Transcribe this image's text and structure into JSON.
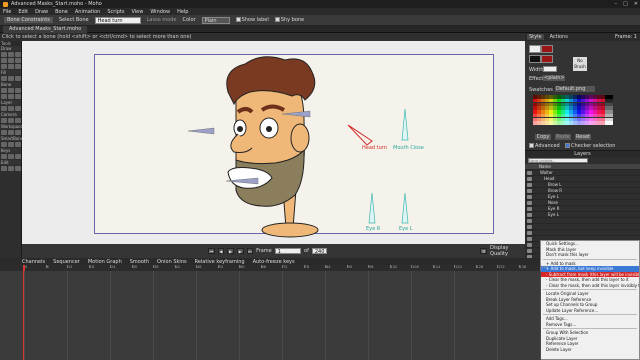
{
  "window": {
    "title": "Advanced Masks_Start.moho - Moho"
  },
  "menu": [
    "File",
    "Edit",
    "Draw",
    "Bone",
    "Animation",
    "Scripts",
    "View",
    "Window",
    "Help"
  ],
  "options": {
    "bone_constraints": "Bone Constraints",
    "select_bone": "Select Bone",
    "bone_name": "Head turn",
    "lasso_mode": "Lasso mode",
    "color_label": "Color",
    "color_value": "Plain",
    "show_label": "Show label",
    "shy_bone": "Shy bone"
  },
  "doc_tab": "Advanced Masks_Start.moho",
  "hint": "Click to select a bone (hold <shift> or <ctrl/cmd> to select more than one)",
  "frame_readout": "Frame: 1",
  "tools_sections": [
    "Draw",
    "Fill",
    "Bone",
    "Layer",
    "Camera",
    "Workspace",
    "SmartBones",
    "Keys",
    "Edit"
  ],
  "tools_title": "Tools",
  "style_panel": {
    "tabs": [
      "Style",
      "Actions"
    ],
    "width_label": "Width",
    "effect_label": "Effect",
    "effect_value": "<plain>",
    "no_brush": "No Brush",
    "swatches_label": "Swatches",
    "swatches_file": "Default.png",
    "copy": "Copy",
    "paste": "Paste",
    "reset": "Reset",
    "advanced": "Advanced",
    "checker": "Checker selection"
  },
  "layers": {
    "title": "Layers",
    "search_placeholder": "Name contains...",
    "col_name": "Name",
    "rows": [
      "Walter",
      "Head",
      "Brow L",
      "Brow R",
      "Eye L",
      "Nose",
      "Eye R",
      "Eye L"
    ]
  },
  "bone_labels": {
    "head_turn": "Head turn",
    "mouth_close": "Mouth Close",
    "eye_r": "Eye R",
    "eye_l": "Eye L"
  },
  "context_menu": [
    "Quick Settings...",
    "Mask this layer",
    "Don't mask this layer",
    "+ Add to mask",
    "+ Add to mask, but keep invisible",
    "- Subtract from mask (this layer will be invisible)",
    "- Clear the mask, then add this layer to it",
    "- Clear the mask, then add this layer invisibly to it",
    "Locate Original Layer",
    "Break Layer Reference",
    "Set up Channels to Group",
    "Update Layer Reference...",
    "Add Tags...",
    "Remove Tags...",
    "Group With Selection",
    "Duplicate Layer",
    "Reference Layer",
    "Delete Layer"
  ],
  "playbar": {
    "frame_label": "Frame",
    "frame_value": "1",
    "of_label": "of",
    "end_value": "240",
    "display_quality": "Display Quality"
  },
  "timeline": {
    "tabs": [
      "Channels",
      "Sequencer",
      "Motion Graph",
      "Smooth",
      "Onion Skins",
      "Relative keyframing",
      "Auto-freeze keys"
    ],
    "ruler": [
      "0",
      "6",
      "12",
      "18",
      "24",
      "30",
      "36",
      "42",
      "48",
      "54",
      "60",
      "66",
      "72",
      "78",
      "84",
      "90",
      "96",
      "102",
      "108",
      "114",
      "120",
      "126",
      "132",
      "138",
      "144"
    ]
  },
  "colors": {
    "accent": "#3a78d6",
    "highlight": "#d42828",
    "bone": "#9aa0c8"
  }
}
